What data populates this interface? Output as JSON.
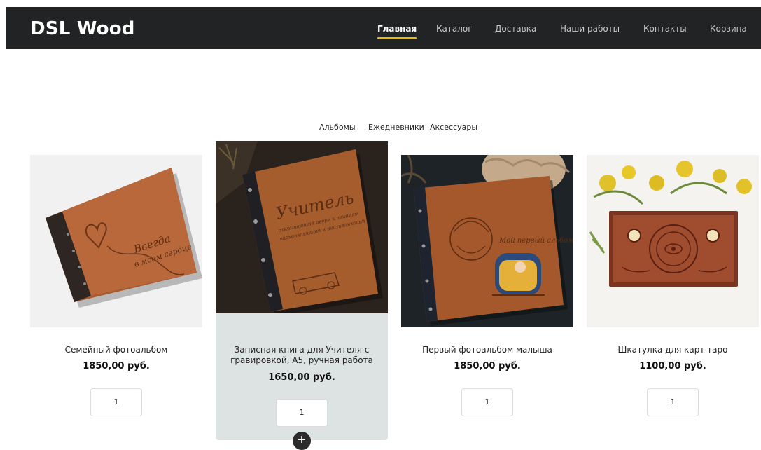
{
  "header": {
    "logo": "DSL Wood",
    "nav": [
      {
        "label": "Главная",
        "active": true
      },
      {
        "label": "Каталог",
        "active": false
      },
      {
        "label": "Доставка",
        "active": false
      },
      {
        "label": "Наши работы",
        "active": false
      },
      {
        "label": "Контакты",
        "active": false
      },
      {
        "label": "Корзина",
        "active": false
      }
    ],
    "accent_color": "#f2b705",
    "background": "#222324"
  },
  "categories": [
    "Альбомы",
    "Ежедневники",
    "Аксессуары"
  ],
  "products": [
    {
      "title": "Семейный фотоальбом",
      "price": "1850,00 руб.",
      "quantity": "1",
      "image": "family-photo-album-image"
    },
    {
      "title": "Записная книга для Учителя с гравировкой, А5, ручная работа",
      "price": "1650,00 руб.",
      "quantity": "1",
      "image": "teacher-notebook-image"
    },
    {
      "title": "Первый фотоальбом малыша",
      "price": "1850,00 руб.",
      "quantity": "1",
      "image": "baby-photo-album-image"
    },
    {
      "title": "Шкатулка для карт таро",
      "price": "1100,00 руб.",
      "quantity": "1",
      "image": "tarot-box-image"
    }
  ],
  "add_button_icon": "plus-icon",
  "hover_card_color": "#dde3e2"
}
